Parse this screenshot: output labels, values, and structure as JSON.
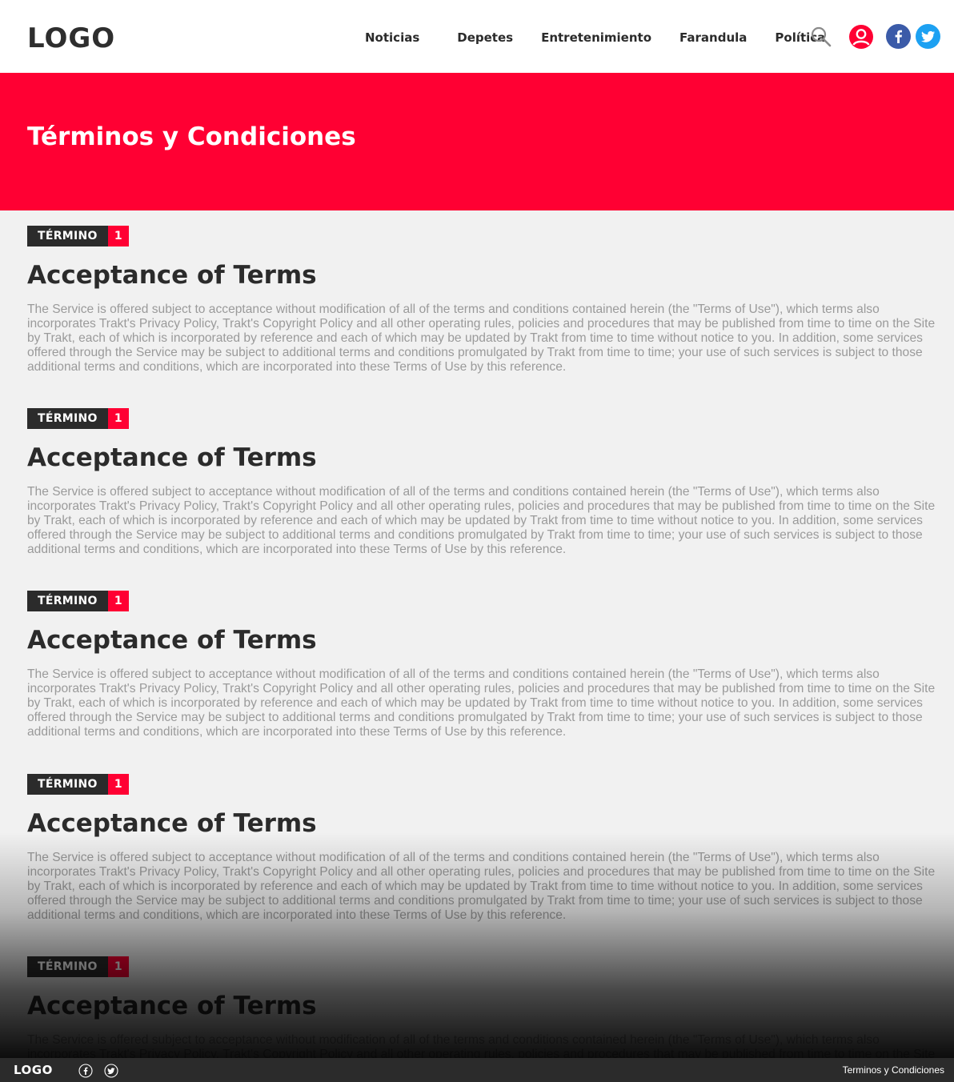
{
  "header": {
    "logo": "LOGO",
    "nav": [
      "Noticias",
      "Depetes",
      "Entretenimiento",
      "Farandula",
      "Política"
    ],
    "icons": [
      "search-icon",
      "user-icon",
      "facebook-icon",
      "twitter-icon"
    ]
  },
  "hero": {
    "title": "Términos y Condiciones"
  },
  "sections": [
    {
      "badge_label": "TÉRMINO",
      "badge_number": "1",
      "title": "Acceptance of Terms",
      "body": "The Service is offered subject to acceptance without modification of all of the terms and conditions contained herein (the \"Terms of Use\"), which terms also incorporates Trakt's Privacy Policy, Trakt's Copyright Policy and all other operating rules, policies and procedures that may be published from time to time on the Site by Trakt, each of which is incorporated by reference and each of which may be updated by Trakt from time to time without notice to you. In addition, some services offered through the Service may be subject to additional terms and conditions promulgated by Trakt from time to time; your use of such services is subject to those additional terms and conditions, which are incorporated into these Terms of Use by this reference."
    },
    {
      "badge_label": "TÉRMINO",
      "badge_number": "1",
      "title": "Acceptance of Terms",
      "body": "The Service is offered subject to acceptance without modification of all of the terms and conditions contained herein (the \"Terms of Use\"), which terms also incorporates Trakt's Privacy Policy, Trakt's Copyright Policy and all other operating rules, policies and procedures that may be published from time to time on the Site by Trakt, each of which is incorporated by reference and each of which may be updated by Trakt from time to time without notice to you. In addition, some services offered through the Service may be subject to additional terms and conditions promulgated by Trakt from time to time; your use of such services is subject to those additional terms and conditions, which are incorporated into these Terms of Use by this reference."
    },
    {
      "badge_label": "TÉRMINO",
      "badge_number": "1",
      "title": "Acceptance of Terms",
      "body": "The Service is offered subject to acceptance without modification of all of the terms and conditions contained herein (the \"Terms of Use\"), which terms also incorporates Trakt's Privacy Policy, Trakt's Copyright Policy and all other operating rules, policies and procedures that may be published from time to time on the Site by Trakt, each of which is incorporated by reference and each of which may be updated by Trakt from time to time without notice to you. In addition, some services offered through the Service may be subject to additional terms and conditions promulgated by Trakt from time to time; your use of such services is subject to those additional terms and conditions, which are incorporated into these Terms of Use by this reference."
    },
    {
      "badge_label": "TÉRMINO",
      "badge_number": "1",
      "title": "Acceptance of Terms",
      "body": "The Service is offered subject to acceptance without modification of all of the terms and conditions contained herein (the \"Terms of Use\"), which terms also incorporates Trakt's Privacy Policy, Trakt's Copyright Policy and all other operating rules, policies and procedures that may be published from time to time on the Site by Trakt, each of which is incorporated by reference and each of which may be updated by Trakt from time to time without notice to you. In addition, some services offered through the Service may be subject to additional terms and conditions promulgated by Trakt from time to time; your use of such services is subject to those additional terms and conditions, which are incorporated into these Terms of Use by this reference."
    },
    {
      "badge_label": "TÉRMINO",
      "badge_number": "1",
      "title": "Acceptance of Terms",
      "body": "The Service is offered subject to acceptance without modification of all of the terms and conditions contained herein (the \"Terms of Use\"), which terms also incorporates Trakt's Privacy Policy, Trakt's Copyright Policy and all other operating rules, policies and procedures that may be published from time to time on the Site by Trakt, each of which is incorporated by reference and each of which may be updated by Trakt from time to time without notice to you. In addition, some services offered through the Service may be subject to additional terms and conditions promulgated by Trakt from time to time; your use of such services is subject to those additional terms and conditions, which are incorporated into these Terms of Use by this reference."
    }
  ],
  "footer": {
    "logo": "LOGO",
    "icons": [
      "facebook-icon",
      "twitter-icon"
    ],
    "link": "Terminos y Condiciones"
  },
  "colors": {
    "accent": "#ff0033",
    "dark": "#2b2b2b",
    "background": "#f1f1f1",
    "facebook": "#3b5ba8",
    "twitter": "#1da1f2"
  }
}
